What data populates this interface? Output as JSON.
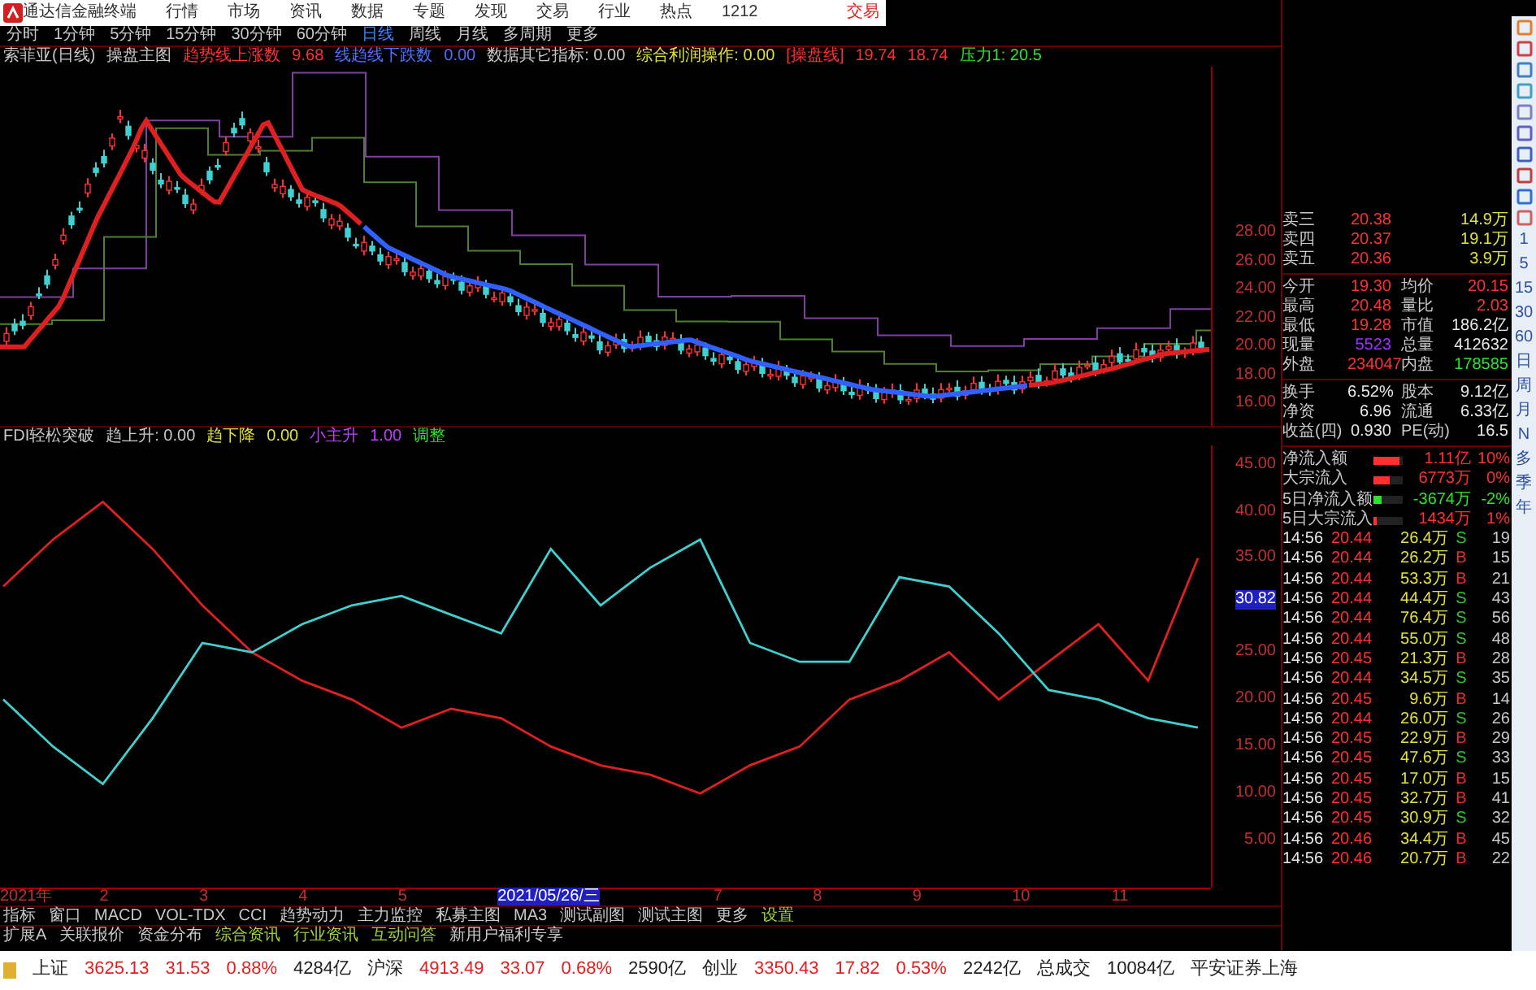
{
  "menu_bar": {
    "app_title": "通达信金融终端",
    "items": [
      "行情",
      "市场",
      "资讯",
      "数据",
      "专题",
      "发现",
      "交易",
      "行业",
      "热点",
      "1212"
    ],
    "trade_link": "交易"
  },
  "period_bar": {
    "items": [
      {
        "label": "分时",
        "selected": false
      },
      {
        "label": "1分钟",
        "selected": false
      },
      {
        "label": "5分钟",
        "selected": false
      },
      {
        "label": "15分钟",
        "selected": false
      },
      {
        "label": "30分钟",
        "selected": false
      },
      {
        "label": "60分钟",
        "selected": false
      },
      {
        "label": "日线",
        "selected": true
      },
      {
        "label": "周线",
        "selected": false
      },
      {
        "label": "月线",
        "selected": false
      },
      {
        "label": "多周期",
        "selected": false
      },
      {
        "label": "更多",
        "selected": false
      }
    ]
  },
  "main_chart": {
    "legend": [
      {
        "text": "索菲亚(日线)",
        "color": "#c8c8c8"
      },
      {
        "text": "操盘主图",
        "color": "#c8c8c8"
      },
      {
        "text": "趋势线上涨数",
        "color": "#ff3030"
      },
      {
        "text": "9.68",
        "color": "#ff3030"
      },
      {
        "text": "线趋线下跌数",
        "color": "#5070ff"
      },
      {
        "text": "0.00",
        "color": "#5070ff"
      },
      {
        "text": "数据其它指标: 0.00",
        "color": "#c8c8c8"
      },
      {
        "text": "综合利润操作: 0.00",
        "color": "#e0e040"
      },
      {
        "text": "[操盘线]",
        "color": "#ff3030"
      },
      {
        "text": "19.74",
        "color": "#ff3030"
      },
      {
        "text": "18.74",
        "color": "#ff3030"
      },
      {
        "text": "压力1: 20.5",
        "color": "#30e030"
      }
    ],
    "price_axis": [
      "28.00",
      "26.00",
      "24.00",
      "22.00",
      "20.00",
      "18.00",
      "16.00"
    ]
  },
  "sub_chart": {
    "legend": [
      {
        "text": "FDI轻松突破",
        "color": "#c8c8c8"
      },
      {
        "text": "趋上升: 0.00",
        "color": "#c8c8c8"
      },
      {
        "text": "趋下降",
        "color": "#e0e040"
      },
      {
        "text": "0.00",
        "color": "#e0e040"
      },
      {
        "text": "小主升",
        "color": "#c040ff"
      },
      {
        "text": "1.00",
        "color": "#c040ff"
      },
      {
        "text": "调整",
        "color": "#30e030"
      }
    ],
    "cursor_value": "30.82",
    "chart_data": {
      "type": "line",
      "ylim": [
        0,
        47
      ],
      "yticks": [
        {
          "value": 45,
          "label": "45.00"
        },
        {
          "value": 40,
          "label": "40.00"
        },
        {
          "value": 35,
          "label": "35.00"
        },
        {
          "value": 25,
          "label": "25.00"
        },
        {
          "value": 20,
          "label": "20.00"
        },
        {
          "value": 15,
          "label": "15.00"
        },
        {
          "value": 10,
          "label": "10.00"
        },
        {
          "value": 5,
          "label": "5.00"
        }
      ],
      "series": [
        {
          "color": "#e02020",
          "values": [
            32,
            37,
            41,
            36,
            30,
            25,
            22,
            20,
            17,
            19,
            18,
            15,
            13,
            12,
            10,
            13,
            15,
            20,
            22,
            25,
            20,
            24,
            28,
            22,
            35
          ]
        },
        {
          "color": "#40d0d0",
          "values": [
            20,
            15,
            11,
            18,
            26,
            25,
            28,
            30,
            31,
            29,
            27,
            36,
            30,
            34,
            37,
            26,
            24,
            24,
            33,
            32,
            27,
            21,
            20,
            18,
            17
          ]
        }
      ]
    }
  },
  "date_axis": [
    {
      "text": "2021年",
      "selected": false
    },
    {
      "text": "2",
      "selected": false
    },
    {
      "text": "3",
      "selected": false
    },
    {
      "text": "4",
      "selected": false
    },
    {
      "text": "5",
      "selected": false
    },
    {
      "text": "2021/05/26/三",
      "selected": true
    },
    {
      "text": "7",
      "selected": false
    },
    {
      "text": "8",
      "selected": false
    },
    {
      "text": "9",
      "selected": false
    },
    {
      "text": "10",
      "selected": false
    },
    {
      "text": "11",
      "selected": false
    }
  ],
  "indicator_tabs": [
    {
      "label": "指标",
      "kind": "plain"
    },
    {
      "label": "窗口",
      "kind": "plain"
    },
    {
      "label": "MACD",
      "kind": "plain"
    },
    {
      "label": "VOL-TDX",
      "kind": "plain"
    },
    {
      "label": "CCI",
      "kind": "plain"
    },
    {
      "label": "趋势动力",
      "kind": "plain"
    },
    {
      "label": "主力监控",
      "kind": "plain"
    },
    {
      "label": "私募主图",
      "kind": "plain"
    },
    {
      "label": "MA3",
      "kind": "plain"
    },
    {
      "label": "测试副图",
      "kind": "plain"
    },
    {
      "label": "测试主图",
      "kind": "plain"
    },
    {
      "label": "更多",
      "kind": "plain"
    },
    {
      "label": "设置",
      "kind": "highlight"
    }
  ],
  "extension_tabs": [
    {
      "label": "扩展A",
      "kind": "plain"
    },
    {
      "label": "关联报价",
      "kind": "plain"
    },
    {
      "label": "资金分布",
      "kind": "plain"
    },
    {
      "label": "综合资讯",
      "kind": "highlight"
    },
    {
      "label": "行业资讯",
      "kind": "highlight"
    },
    {
      "label": "互动问答",
      "kind": "highlight"
    },
    {
      "label": "新用户福利专享",
      "kind": "plain"
    }
  ],
  "quote_panel": {
    "rows": [
      {
        "label": "卖三",
        "value": {
          "text": "20.38",
          "color": "#ff3030"
        },
        "value2": {
          "text": "14.9万",
          "color": "#e0e040"
        }
      },
      {
        "label": "卖四",
        "value": {
          "text": "20.37",
          "color": "#ff3030"
        },
        "value2": {
          "text": "19.1万",
          "color": "#e0e040"
        }
      },
      {
        "label": "卖五",
        "value": {
          "text": "20.36",
          "color": "#ff3030"
        },
        "value2": {
          "text": "3.9万",
          "color": "#e0e040"
        }
      },
      {
        "label": "今开",
        "value": {
          "text": "19.30",
          "color": "#ff3030"
        },
        "label2": "均价",
        "value2": {
          "text": "20.15",
          "color": "#ff3030"
        }
      },
      {
        "label": "最高",
        "value": {
          "text": "20.48",
          "color": "#ff3030"
        },
        "label2": "量比",
        "value2": {
          "text": "2.03",
          "color": "#ff3030"
        }
      },
      {
        "label": "最低",
        "value": {
          "text": "19.28",
          "color": "#ff3030"
        },
        "label2": "市值",
        "value2": {
          "text": "186.2亿",
          "color": "#e8e8e8"
        }
      },
      {
        "label": "现量",
        "value": {
          "text": "5523",
          "color": "#a030ff"
        },
        "label2": "总量",
        "value2": {
          "text": "412632",
          "color": "#e8e8e8"
        }
      },
      {
        "label": "外盘",
        "value": {
          "text": "234047",
          "color": "#ff3030"
        },
        "label2": "内盘",
        "value2": {
          "text": "178585",
          "color": "#30e030"
        }
      },
      {
        "label": "换手",
        "value": {
          "text": "6.52%",
          "color": "#e8e8e8"
        },
        "label2": "股本",
        "value2": {
          "text": "9.12亿",
          "color": "#e8e8e8"
        }
      },
      {
        "label": "净资",
        "value": {
          "text": "6.96",
          "color": "#e8e8e8"
        },
        "label2": "流通",
        "value2": {
          "text": "6.33亿",
          "color": "#e8e8e8"
        }
      },
      {
        "label": "收益(四)",
        "value": {
          "text": "0.930",
          "color": "#e8e8e8"
        },
        "label2": "PE(动)",
        "value2": {
          "text": "16.5",
          "color": "#e8e8e8"
        }
      }
    ],
    "fund_flow": [
      {
        "label": "净流入额",
        "color": "#ff3030",
        "level": 0.9,
        "amount": "1.11亿",
        "share": "10%"
      },
      {
        "label": "大宗流入",
        "color": "#ff3030",
        "level": 0.55,
        "amount": "6773万",
        "share": "0%"
      },
      {
        "label": "5日净流入额",
        "color": "#30e030",
        "level": 0.3,
        "amount": "-3674万",
        "share": "-2%"
      },
      {
        "label": "5日大宗流入",
        "color": "#ff3030",
        "level": 0.12,
        "amount": "1434万",
        "share": "1%"
      }
    ],
    "ticks": [
      {
        "time": "14:56",
        "price": "20.44",
        "volume": "26.4万",
        "side": "S",
        "color": "#30c030",
        "count": "19"
      },
      {
        "time": "14:56",
        "price": "20.44",
        "volume": "26.2万",
        "side": "B",
        "color": "#e03030",
        "count": "15"
      },
      {
        "time": "14:56",
        "price": "20.44",
        "volume": "53.3万",
        "side": "B",
        "color": "#e03030",
        "count": "21"
      },
      {
        "time": "14:56",
        "price": "20.44",
        "volume": "44.4万",
        "side": "S",
        "color": "#30c030",
        "count": "43"
      },
      {
        "time": "14:56",
        "price": "20.44",
        "volume": "76.4万",
        "side": "S",
        "color": "#30c030",
        "count": "56"
      },
      {
        "time": "14:56",
        "price": "20.44",
        "volume": "55.0万",
        "side": "S",
        "color": "#30c030",
        "count": "48"
      },
      {
        "time": "14:56",
        "price": "20.45",
        "volume": "21.3万",
        "side": "B",
        "color": "#e03030",
        "count": "28"
      },
      {
        "time": "14:56",
        "price": "20.44",
        "volume": "34.5万",
        "side": "S",
        "color": "#30c030",
        "count": "35"
      },
      {
        "time": "14:56",
        "price": "20.45",
        "volume": "9.6万",
        "side": "B",
        "color": "#e03030",
        "count": "14"
      },
      {
        "time": "14:56",
        "price": "20.44",
        "volume": "26.0万",
        "side": "S",
        "color": "#30c030",
        "count": "26"
      },
      {
        "time": "14:56",
        "price": "20.45",
        "volume": "22.9万",
        "side": "B",
        "color": "#e03030",
        "count": "29"
      },
      {
        "time": "14:56",
        "price": "20.45",
        "volume": "47.6万",
        "side": "S",
        "color": "#30c030",
        "count": "33"
      },
      {
        "time": "14:56",
        "price": "20.45",
        "volume": "17.0万",
        "side": "B",
        "color": "#e03030",
        "count": "15"
      },
      {
        "time": "14:56",
        "price": "20.45",
        "volume": "32.7万",
        "side": "B",
        "color": "#e03030",
        "count": "41"
      },
      {
        "time": "14:56",
        "price": "20.45",
        "volume": "30.9万",
        "side": "S",
        "color": "#30c030",
        "count": "32"
      },
      {
        "time": "14:56",
        "price": "20.46",
        "volume": "34.4万",
        "side": "B",
        "color": "#e03030",
        "count": "45"
      },
      {
        "time": "14:56",
        "price": "20.46",
        "volume": "20.7万",
        "side": "B",
        "color": "#e03030",
        "count": "22"
      }
    ]
  },
  "right_toolbar": {
    "periods": [
      "1",
      "5",
      "15",
      "30",
      "60",
      "日",
      "周",
      "月",
      "N",
      "多",
      "季",
      "年"
    ]
  },
  "status_bar": [
    {
      "text": "上证",
      "color": "#202020"
    },
    {
      "text": "3625.13",
      "color": "#e02020"
    },
    {
      "text": "31.53",
      "color": "#e02020"
    },
    {
      "text": "0.88%",
      "color": "#e02020"
    },
    {
      "text": "4284亿",
      "color": "#202020"
    },
    {
      "text": "沪深",
      "color": "#202020"
    },
    {
      "text": "4913.49",
      "color": "#e02020"
    },
    {
      "text": "33.07",
      "color": "#e02020"
    },
    {
      "text": "0.68%",
      "color": "#e02020"
    },
    {
      "text": "2590亿",
      "color": "#202020"
    },
    {
      "text": "创业",
      "color": "#202020"
    },
    {
      "text": "3350.43",
      "color": "#e02020"
    },
    {
      "text": "17.82",
      "color": "#e02020"
    },
    {
      "text": "0.53%",
      "color": "#e02020"
    },
    {
      "text": "2242亿",
      "color": "#202020"
    },
    {
      "text": "总成交",
      "color": "#202020"
    },
    {
      "text": "10084亿",
      "color": "#202020"
    },
    {
      "text": "平安证券上海",
      "color": "#202020"
    }
  ]
}
